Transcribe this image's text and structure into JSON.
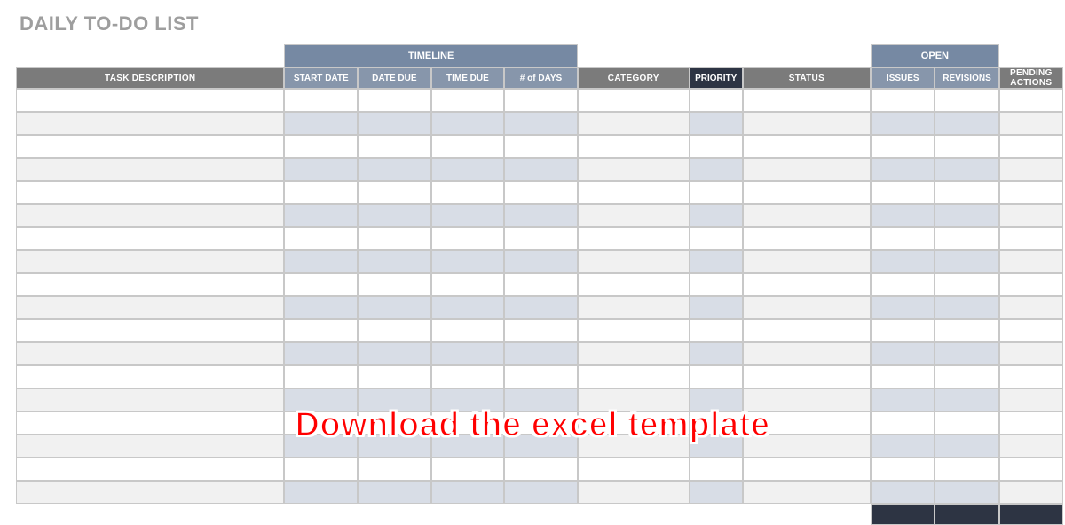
{
  "title": "DAILY TO-DO LIST",
  "group_headers": {
    "timeline": "TIMELINE",
    "open": "OPEN"
  },
  "columns": {
    "task": "TASK DESCRIPTION",
    "start_date": "START DATE",
    "date_due": "DATE DUE",
    "time_due": "TIME DUE",
    "days": "# of DAYS",
    "category": "CATEGORY",
    "priority": "PRIORITY",
    "status": "STATUS",
    "issues": "ISSUES",
    "revisions": "REVISIONS",
    "pending": "PENDING ACTIONS"
  },
  "rows": [
    {},
    {},
    {},
    {},
    {},
    {},
    {},
    {},
    {},
    {},
    {},
    {},
    {},
    {},
    {},
    {},
    {},
    {}
  ],
  "overlay_text": "Download the excel template",
  "chart_data": {
    "type": "table",
    "title": "DAILY TO-DO LIST",
    "column_groups": [
      {
        "label": "",
        "columns": [
          "TASK DESCRIPTION"
        ]
      },
      {
        "label": "TIMELINE",
        "columns": [
          "START DATE",
          "DATE DUE",
          "TIME DUE",
          "# of DAYS"
        ]
      },
      {
        "label": "",
        "columns": [
          "CATEGORY",
          "PRIORITY",
          "STATUS"
        ]
      },
      {
        "label": "OPEN",
        "columns": [
          "ISSUES",
          "REVISIONS"
        ]
      },
      {
        "label": "",
        "columns": [
          "PENDING ACTIONS"
        ]
      }
    ],
    "columns": [
      "TASK DESCRIPTION",
      "START DATE",
      "DATE DUE",
      "TIME DUE",
      "# of DAYS",
      "CATEGORY",
      "PRIORITY",
      "STATUS",
      "ISSUES",
      "REVISIONS",
      "PENDING ACTIONS"
    ],
    "rows": [
      [
        "",
        "",
        "",
        "",
        "",
        "",
        "",
        "",
        "",
        "",
        ""
      ],
      [
        "",
        "",
        "",
        "",
        "",
        "",
        "",
        "",
        "",
        "",
        ""
      ],
      [
        "",
        "",
        "",
        "",
        "",
        "",
        "",
        "",
        "",
        "",
        ""
      ],
      [
        "",
        "",
        "",
        "",
        "",
        "",
        "",
        "",
        "",
        "",
        ""
      ],
      [
        "",
        "",
        "",
        "",
        "",
        "",
        "",
        "",
        "",
        "",
        ""
      ],
      [
        "",
        "",
        "",
        "",
        "",
        "",
        "",
        "",
        "",
        "",
        ""
      ],
      [
        "",
        "",
        "",
        "",
        "",
        "",
        "",
        "",
        "",
        "",
        ""
      ],
      [
        "",
        "",
        "",
        "",
        "",
        "",
        "",
        "",
        "",
        "",
        ""
      ],
      [
        "",
        "",
        "",
        "",
        "",
        "",
        "",
        "",
        "",
        "",
        ""
      ],
      [
        "",
        "",
        "",
        "",
        "",
        "",
        "",
        "",
        "",
        "",
        ""
      ],
      [
        "",
        "",
        "",
        "",
        "",
        "",
        "",
        "",
        "",
        "",
        ""
      ],
      [
        "",
        "",
        "",
        "",
        "",
        "",
        "",
        "",
        "",
        "",
        ""
      ],
      [
        "",
        "",
        "",
        "",
        "",
        "",
        "",
        "",
        "",
        "",
        ""
      ],
      [
        "",
        "",
        "",
        "",
        "",
        "",
        "",
        "",
        "",
        "",
        ""
      ],
      [
        "",
        "",
        "",
        "",
        "",
        "",
        "",
        "",
        "",
        "",
        ""
      ],
      [
        "",
        "",
        "",
        "",
        "",
        "",
        "",
        "",
        "",
        "",
        ""
      ],
      [
        "",
        "",
        "",
        "",
        "",
        "",
        "",
        "",
        "",
        "",
        ""
      ],
      [
        "",
        "",
        "",
        "",
        "",
        "",
        "",
        "",
        "",
        "",
        ""
      ]
    ]
  }
}
